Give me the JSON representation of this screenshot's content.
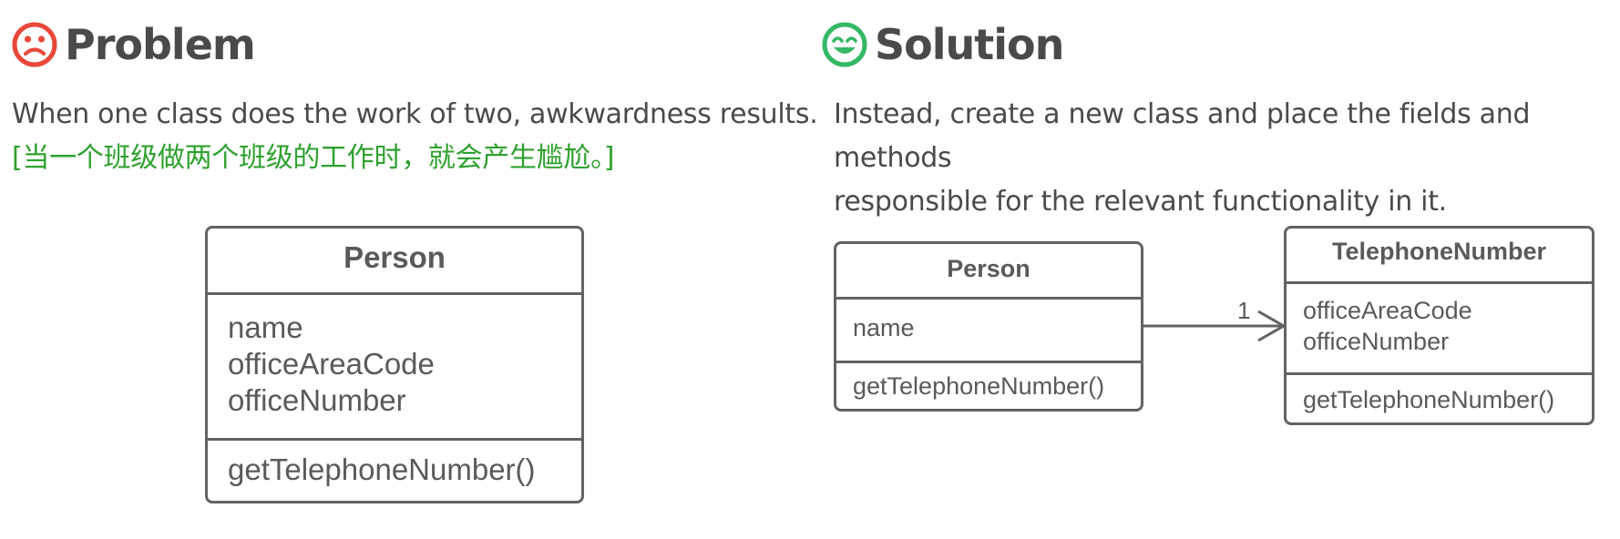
{
  "problem": {
    "heading": "Problem",
    "icon": "sad-face-icon",
    "icon_color": "#e8473a",
    "description": "When one class does the work of two, awkwardness results.",
    "translation": "[当一个班级做两个班级的工作时，就会产生尴尬。]",
    "translation_color": "#2ea12e",
    "person_class": {
      "name": "Person",
      "fields": [
        "name",
        "officeAreaCode",
        "officeNumber"
      ],
      "methods": [
        "getTelephoneNumber()"
      ]
    }
  },
  "solution": {
    "heading": "Solution",
    "icon": "happy-face-icon",
    "icon_color": "#35b866",
    "description_line1": "Instead, create a new class and place the fields and methods",
    "description_line2": "responsible for the relevant functionality in it.",
    "person_class": {
      "name": "Person",
      "fields": [
        "name"
      ],
      "methods": [
        "getTelephoneNumber()"
      ]
    },
    "telephone_class": {
      "name": "TelephoneNumber",
      "fields": [
        "officeAreaCode",
        "officeNumber"
      ],
      "methods": [
        "getTelephoneNumber()"
      ]
    },
    "association": {
      "multiplicity": "1"
    }
  },
  "colors": {
    "text": "#4a4a4a",
    "border": "#636363"
  }
}
